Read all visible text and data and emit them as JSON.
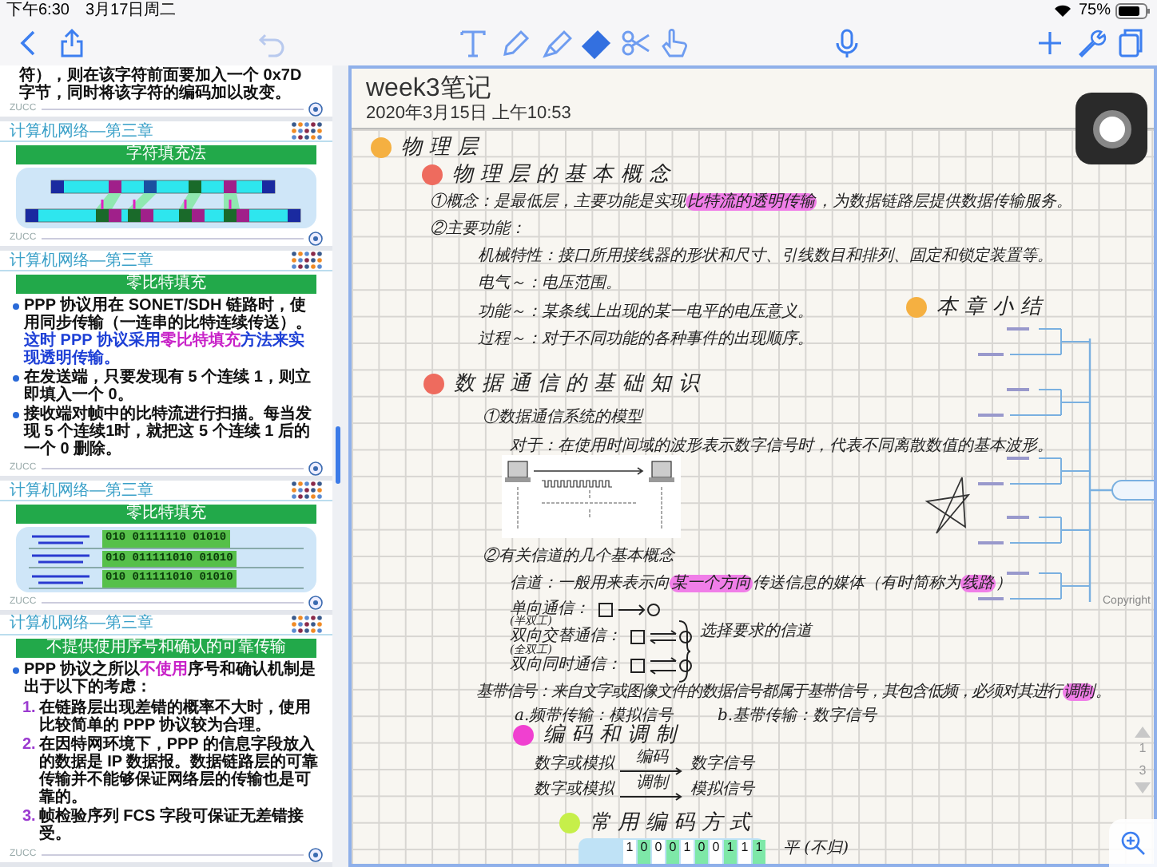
{
  "status_bar": {
    "time": "下午6:30",
    "date": "3月17日周二",
    "battery": "75%"
  },
  "toolbar": {
    "tools": [
      {
        "kind": "text",
        "selected": false
      },
      {
        "kind": "pen",
        "selected": false
      },
      {
        "kind": "highlighter",
        "selected": false
      },
      {
        "kind": "eraser",
        "selected": true
      },
      {
        "kind": "lasso",
        "selected": false
      },
      {
        "kind": "hand",
        "selected": false
      }
    ]
  },
  "slides": [
    {
      "kind": "paragraph",
      "text": "符），则在该字符前面要加入一个 0x7D 字节，同时将该字符的编码加以改变。"
    },
    {
      "kind": "footer",
      "label": "ZUCC"
    },
    {
      "kind": "header",
      "label": "计算机网络—第三章"
    },
    {
      "kind": "title",
      "text": "字符填充法"
    },
    {
      "kind": "byte_diagram"
    },
    {
      "kind": "footer",
      "label": "ZUCC"
    },
    {
      "kind": "header",
      "label": "计算机网络—第三章"
    },
    {
      "kind": "title",
      "text": "零比特填充"
    },
    {
      "kind": "bullets",
      "items": [
        {
          "segments": [
            {
              "text": "PPP 协议用在 SONET/SDH 链路时，使用同步传输（一连串的比特连续传送）。"
            },
            {
              "text": "这时 PPP 协议采用",
              "color": "#1d3fd6"
            },
            {
              "text": "零比特填充",
              "color": "#c822c8"
            },
            {
              "text": "方法来实现透明传输。",
              "color": "#1d3fd6"
            }
          ]
        },
        {
          "segments": [
            {
              "text": "在发送端，只要发现有 5 个连续 1，则立即填入一个 0。"
            }
          ]
        },
        {
          "segments": [
            {
              "text": "接收端对帧中的比特流进行扫描。每当发现 5 个连续1时，就把这 5 个连续 1 后的一个 0 删除。"
            }
          ]
        }
      ]
    },
    {
      "kind": "footer",
      "label": "ZUCC"
    },
    {
      "kind": "header",
      "label": "计算机网络—第三章"
    },
    {
      "kind": "title",
      "text": "零比特填充"
    },
    {
      "kind": "bit_rows",
      "rows": [
        "010 01111110 01010",
        "010 011111010 01010",
        "010 011111010 01010"
      ]
    },
    {
      "kind": "footer",
      "label": "ZUCC"
    },
    {
      "kind": "header",
      "label": "计算机网络—第三章"
    },
    {
      "kind": "title",
      "text": "不提供使用序号和确认的可靠传输"
    },
    {
      "kind": "bullets",
      "items": [
        {
          "segments": [
            {
              "text": "PPP 协议之所以"
            },
            {
              "text": "不使用",
              "color": "#c822c8"
            },
            {
              "text": "序号和确认机制是出于以下的考虑："
            }
          ]
        }
      ]
    },
    {
      "kind": "numbered",
      "items": [
        {
          "number": "1.",
          "text": "在链路层出现差错的概率不大时，使用比较简单的 PPP 协议较为合理。"
        },
        {
          "number": "2.",
          "text": "在因特网环境下，PPP 的信息字段放入的数据是 IP 数据报。数据链路层的可靠传输并不能够保证网络层的传输也是可靠的。"
        },
        {
          "number": "3.",
          "text": "帧检验序列 FCS 字段可保证无差错接受。"
        }
      ]
    },
    {
      "kind": "footer",
      "label": "ZUCC"
    }
  ],
  "note": {
    "title": "week3笔记",
    "date": "2020年3月15日 上午10:53",
    "items": [
      {
        "kind": "dot_heading",
        "color": "#f5b041",
        "text": "物理层"
      },
      {
        "kind": "dot_heading",
        "color": "#ee6b5e",
        "text": "物理层的基本概念"
      },
      {
        "kind": "line",
        "segments": [
          {
            "text": "①概念：是最低层，主要功能是实现"
          },
          {
            "text": "比特流的透明传输",
            "highlight": true
          },
          {
            "text": "，为数据链路层提供数据传输服务。"
          }
        ]
      },
      {
        "kind": "line",
        "segments": [
          {
            "text": "②主要功能：",
            "highlight": false
          }
        ]
      },
      {
        "kind": "line",
        "segments": [
          {
            "text": "机械特性：接口所用接线器的形状和尺寸、引线数目和排列、固定和锁定装置等。",
            "highlight": false
          }
        ]
      },
      {
        "kind": "line",
        "segments": [
          {
            "text": "电气～：电压范围。",
            "highlight": false
          }
        ]
      },
      {
        "kind": "line",
        "segments": [
          {
            "text": "功能～：某条线上出现的某一电平的电压意义。",
            "highlight": false
          }
        ]
      },
      {
        "kind": "line",
        "segments": [
          {
            "text": "过程～：对于不同功能的各种事件的出现顺序。",
            "highlight": false
          }
        ]
      },
      {
        "kind": "dot_heading",
        "color": "#f5b041",
        "text": "本章小结"
      },
      {
        "kind": "mindmap",
        "caption": "Copyright"
      },
      {
        "kind": "dot_heading",
        "color": "#ee6b5e",
        "text": "数据通信的基础知识"
      },
      {
        "kind": "line",
        "segments": [
          {
            "text": "①数据通信系统的模型",
            "highlight": false
          }
        ]
      },
      {
        "kind": "line",
        "segments": [
          {
            "text": "对于：在使用时间域的波形表示数字信号时，代表不同离散数值的基本波形。",
            "highlight": false
          }
        ]
      },
      {
        "kind": "model_diagram"
      },
      {
        "kind": "line",
        "segments": [
          {
            "text": "②有关信道的几个基本概念",
            "highlight": false
          }
        ]
      },
      {
        "kind": "line",
        "segments": [
          {
            "text": "信道：一般用来表示向"
          },
          {
            "text": "某一个方向",
            "highlight": true
          },
          {
            "text": "传送信息的媒体（有时简称为"
          },
          {
            "text": "线路",
            "highlight": true
          },
          {
            "text": "）"
          }
        ]
      },
      {
        "kind": "simplex",
        "text": "单向通信："
      },
      {
        "kind": "half_duplex",
        "note": "(半双工)",
        "text": "双向交替通信："
      },
      {
        "kind": "full_duplex",
        "note": "(全双工)",
        "text": "双向同时通信："
      },
      {
        "kind": "brace",
        "text": "选择要求的信道"
      },
      {
        "kind": "line",
        "segments": [
          {
            "text": "基带信号：来自文字或图像文件的数据信号都属于基带信号，其包含低频，必须对其进行"
          },
          {
            "text": "调制",
            "highlight": true
          },
          {
            "text": "。"
          }
        ]
      },
      {
        "kind": "line",
        "segments": [
          {
            "text": "a.频带传输：模拟信号",
            "highlight": false
          }
        ]
      },
      {
        "kind": "line",
        "segments": [
          {
            "text": "b.基带传输：数字信号",
            "highlight": false
          }
        ]
      },
      {
        "kind": "dot_heading",
        "color": "#f040d0",
        "text": "编码和调制"
      },
      {
        "kind": "flow",
        "from": "数字或模拟",
        "via": "编码",
        "to": "数字信号"
      },
      {
        "kind": "flow",
        "from": "数字或模拟",
        "via": "调制",
        "to": "模拟信号"
      },
      {
        "kind": "dot_heading",
        "color": "#c6ef4a",
        "text": "常用编码方式"
      },
      {
        "kind": "encoding_table",
        "bits": [
          "1",
          "0",
          "0",
          "0",
          "1",
          "0",
          "0",
          "1",
          "1",
          "1"
        ]
      },
      {
        "kind": "line",
        "segments": [
          {
            "text": "平 (不归)",
            "highlight": false
          }
        ]
      }
    ],
    "page_nav": {
      "current": "1",
      "total": "3"
    }
  }
}
